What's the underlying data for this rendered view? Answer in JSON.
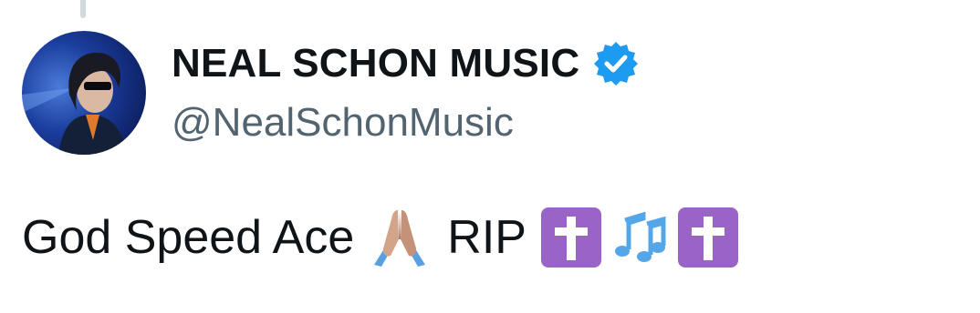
{
  "author": {
    "display_name": "NEAL SCHON MUSIC",
    "handle": "@NealSchonMusic",
    "verified": true,
    "verified_color": "#1d9bf0",
    "avatar_icon": "profile-photo"
  },
  "tweet": {
    "text_main": "God Speed Ace",
    "text_rip": "RIP",
    "emojis": [
      "folded-hands-emoji",
      "latin-cross-emoji",
      "musical-notes-emoji",
      "latin-cross-emoji"
    ]
  },
  "colors": {
    "text_primary": "#0f1419",
    "text_secondary": "#536471",
    "cross_purple": "#9a63c6",
    "notes_blue": "#54a6e8"
  }
}
